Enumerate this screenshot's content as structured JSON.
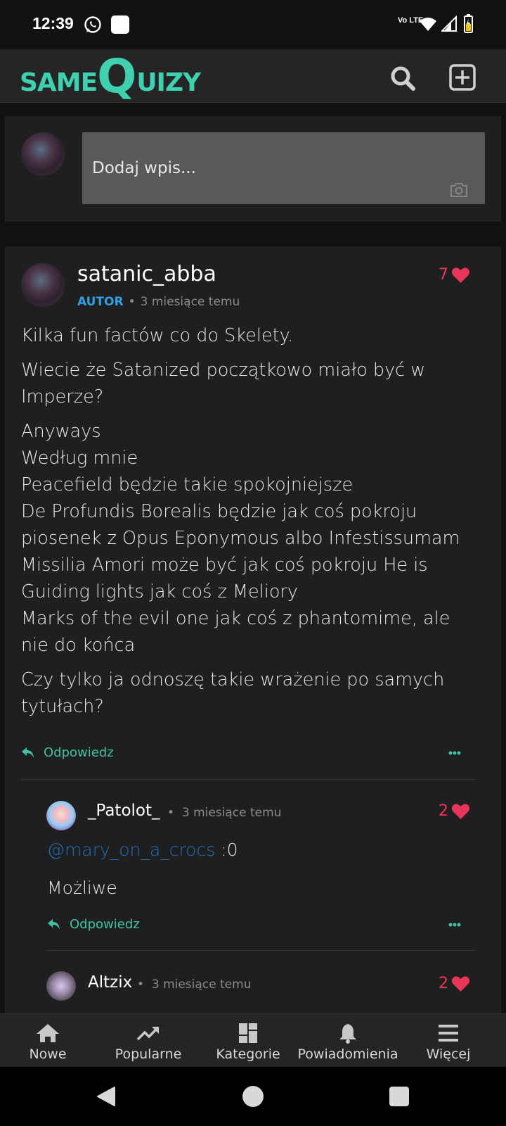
{
  "status_bar": {
    "time": "12:39",
    "network_label": "Vo LTE"
  },
  "header": {
    "logo_same": "SAME",
    "logo_q": "Q",
    "logo_uizy": "UIZY"
  },
  "compose": {
    "placeholder": "Dodaj wpis..."
  },
  "post": {
    "author": "satanic_abba",
    "badge": "AUTOR",
    "time": "3 miesiące temu",
    "likes": "7",
    "paragraphs": [
      [
        "Kilka fun factów co do Skelety."
      ],
      [
        "Wiecie że Satanized początkowo miało być w Imperze?"
      ],
      [
        "Anyways",
        "Według mnie",
        "Peacefield będzie takie spokojniejsze",
        "De Profundis Borealis będzie jak coś pokroju piosenek z Opus Eponymous albo Infestissumam",
        "Missilia Amori może być jak coś pokroju He is",
        "Guiding lights jak coś z Meliory",
        "Marks of the evil one jak coś z phantomime, ale nie do końca"
      ],
      [
        "Czy tylko ja odnoszę takie wrażenie po samych tytułach?"
      ]
    ],
    "reply_label": "Odpowiedz"
  },
  "comments": [
    {
      "author": "_Patolot_",
      "time": "3 miesiące temu",
      "likes": "2",
      "mention": "@mary_on_a_crocs",
      "mention_suffix": " :0",
      "text": "Możliwe",
      "reply_label": "Odpowiedz"
    },
    {
      "author": "Altzix",
      "time": "3 miesiące temu",
      "likes": "2"
    }
  ],
  "bottom_nav": [
    {
      "label": "Nowe",
      "icon": "home-icon"
    },
    {
      "label": "Popularne",
      "icon": "trending-icon"
    },
    {
      "label": "Kategorie",
      "icon": "dashboard-icon"
    },
    {
      "label": "Powiadomienia",
      "icon": "bell-icon"
    },
    {
      "label": "Więcej",
      "icon": "menu-icon"
    }
  ],
  "colors": {
    "brand": "#3fd0b0",
    "like": "#e8365b",
    "badge": "#2ea1e8",
    "mention": "#1f6fc0",
    "reply": "#3fc2a6"
  }
}
